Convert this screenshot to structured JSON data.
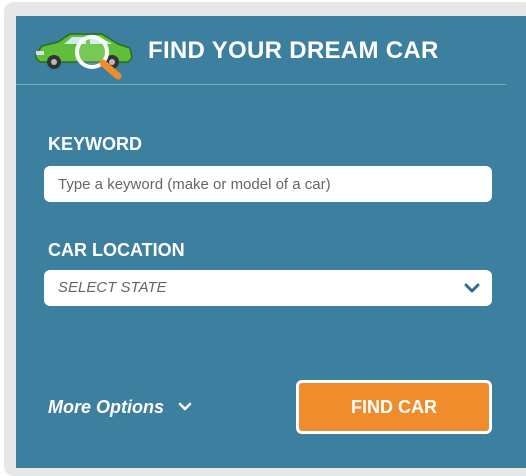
{
  "header": {
    "title": "FIND YOUR DREAM CAR",
    "logo_icon": "car-magnifier-icon"
  },
  "keyword": {
    "label": "KEYWORD",
    "placeholder": "Type a keyword (make or model of a car)",
    "value": ""
  },
  "location": {
    "label": "CAR LOCATION",
    "selected": "SELECT STATE",
    "chevron_icon": "chevron-down-icon"
  },
  "more_options": {
    "label": "More Options",
    "icon": "chevron-down-icon"
  },
  "find_button": {
    "label": "FIND CAR"
  },
  "colors": {
    "panel": "#3d7f9e",
    "accent": "#f08c2b",
    "car": "#5fbf3a",
    "chevron": "#2b6e92"
  }
}
